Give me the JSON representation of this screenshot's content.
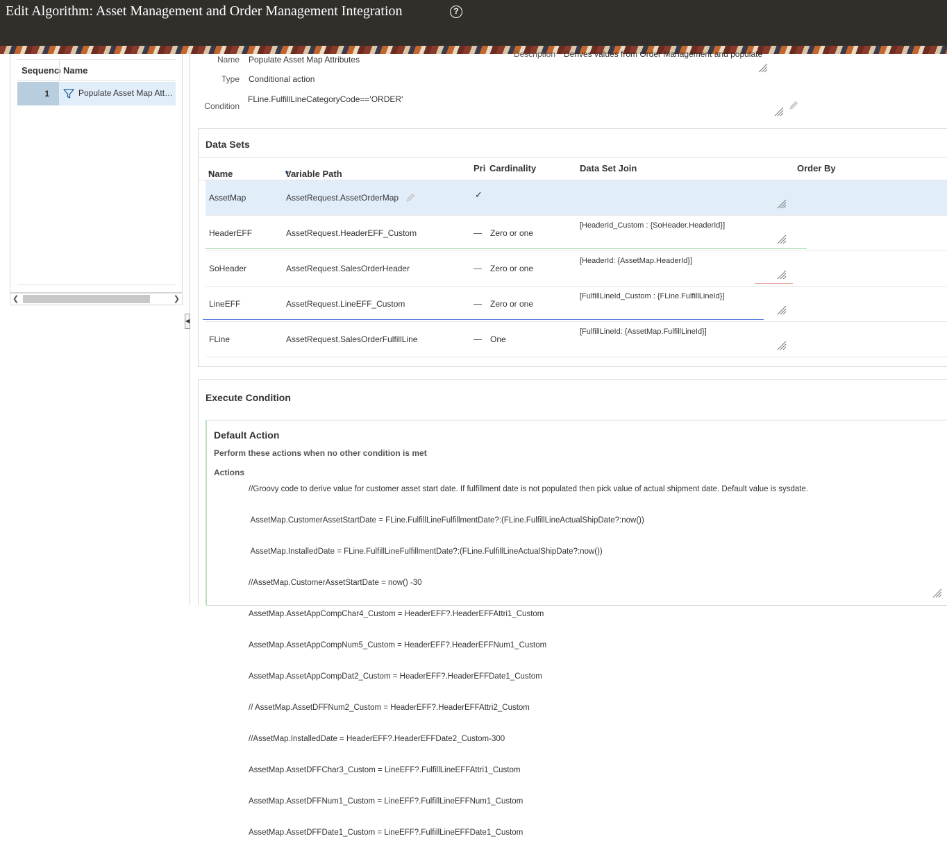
{
  "page": {
    "title": "Edit Algorithm: Asset Management and Order Management Integration",
    "help_icon": "?"
  },
  "left_panel": {
    "columns": [
      "Sequence",
      "Name"
    ],
    "rows": [
      {
        "sequence": "1",
        "icon": "filter-icon",
        "name": "Populate Asset Map Attributes"
      }
    ]
  },
  "details": {
    "name_label": "Name",
    "name_value": "Populate Asset Map Attributes",
    "type_label": "Type",
    "type_value": "Conditional action",
    "condition_label": "Condition",
    "condition_value": "FLine.FulfillLineCategoryCode=='ORDER'",
    "description_label": "Description",
    "description_value": "Derives values from Order Management and populate"
  },
  "data_sets": {
    "title": "Data Sets",
    "columns": {
      "name": "Name",
      "variable_path": "Variable Path",
      "primary": "Pri",
      "cardinality": "Cardinality",
      "join": "Data Set Join",
      "order_by": "Order By"
    },
    "rows": [
      {
        "name": "AssetMap",
        "path": "AssetRequest.AssetOrderMap",
        "primary": "✓",
        "cardinality": "",
        "join": ""
      },
      {
        "name": "HeaderEFF",
        "path": "AssetRequest.HeaderEFF_Custom",
        "primary": "",
        "cardinality": "Zero or one",
        "join": "[HeaderId_Custom : {SoHeader.HeaderId}]"
      },
      {
        "name": "SoHeader",
        "path": "AssetRequest.SalesOrderHeader",
        "primary": "",
        "cardinality": "Zero or one",
        "join": "[HeaderId: {AssetMap.HeaderId}]"
      },
      {
        "name": "LineEFF",
        "path": "AssetRequest.LineEFF_Custom",
        "primary": "",
        "cardinality": "Zero or one",
        "join": "[FulfillLineId_Custom : {FLine.FulfillLineId}]"
      },
      {
        "name": "FLine",
        "path": "AssetRequest.SalesOrderFulfillLine",
        "primary": "",
        "cardinality": "One",
        "join": "[FulfillLineId: {AssetMap.FulfillLineId}]"
      }
    ]
  },
  "execute_condition": {
    "title": "Execute Condition",
    "default_action_title": "Default Action",
    "subtitle": "Perform these actions when no other condition is met",
    "actions_label": "Actions",
    "actions_lines": [
      "//Groovy code to derive value for customer asset start date. If fulfillment date is not populated then pick value of actual shipment date. Default value is sysdate.",
      " AssetMap.CustomerAssetStartDate = FLine.FulfillLineFulfillmentDate?:(FLine.FulfillLineActualShipDate?:now())",
      " AssetMap.InstalledDate = FLine.FulfillLineFulfillmentDate?:(FLine.FulfillLineActualShipDate?:now())",
      "//AssetMap.CustomerAssetStartDate = now() -30",
      "AssetMap.AssetAppCompChar4_Custom = HeaderEFF?.HeaderEFFAttri1_Custom",
      "AssetMap.AssetAppCompNum5_Custom = HeaderEFF?.HeaderEFFNum1_Custom",
      "AssetMap.AssetAppCompDat2_Custom = HeaderEFF?.HeaderEFFDate1_Custom",
      "// AssetMap.AssetDFFNum2_Custom = HeaderEFF?.HeaderEFFAttri2_Custom",
      "//AssetMap.InstalledDate = HeaderEFF?.HeaderEFFDate2_Custom-300",
      "AssetMap.AssetDFFChar3_Custom = LineEFF?.FulfillLineEFFAttri1_Custom",
      "AssetMap.AssetDFFNum1_Custom = LineEFF?.FulfillLineEFFNum1_Custom",
      "AssetMap.AssetDFFDate1_Custom = LineEFF?.FulfillLineEFFDate1_Custom"
    ]
  },
  "colors": {
    "header_bg": "#322f2b",
    "selected_row": "#e1eefa",
    "sequence_cell": "#b8cede"
  }
}
